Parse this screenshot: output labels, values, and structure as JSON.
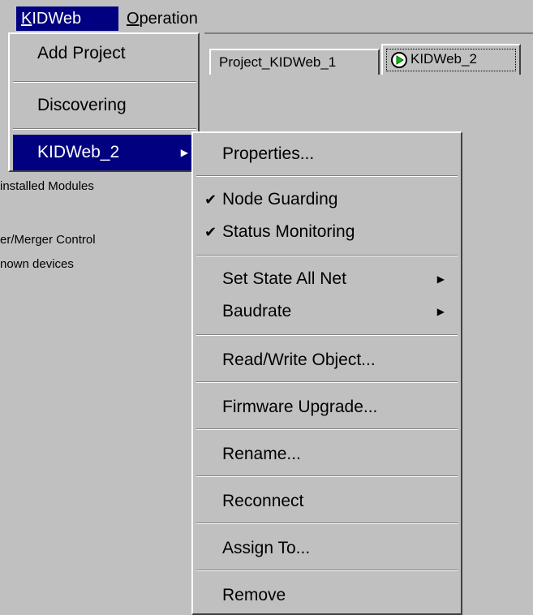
{
  "menubar": {
    "kidweb_prefix": "K",
    "kidweb_rest": "IDWeb",
    "operation_prefix": "O",
    "operation_rest": "peration"
  },
  "tabs": [
    {
      "label": "Project_KIDWeb_1"
    },
    {
      "label": "KIDWeb_2",
      "icon": "green-play-status-icon"
    }
  ],
  "tree": {
    "line1": "installed Modules",
    "line2": "er/Merger Control",
    "line3": "nown devices"
  },
  "dropdown": {
    "items": [
      {
        "label": "Add Project"
      },
      {
        "label": "Discovering"
      },
      {
        "label": "KIDWeb_2",
        "has_submenu": true
      }
    ]
  },
  "submenu": {
    "properties": "Properties...",
    "node_guarding": "Node Guarding",
    "status_monitoring": "Status Monitoring",
    "set_state_all_net": "Set State All Net",
    "baudrate": "Baudrate",
    "read_write_object": "Read/Write Object...",
    "firmware_upgrade": "Firmware Upgrade...",
    "rename": "Rename...",
    "reconnect": "Reconnect",
    "assign_to": "Assign To...",
    "remove": "Remove",
    "check_glyph": "✔",
    "arrow_glyph": "▶"
  },
  "colors": {
    "highlight": "#000080",
    "face": "#c0c0c0",
    "status_green": "#00c000"
  }
}
